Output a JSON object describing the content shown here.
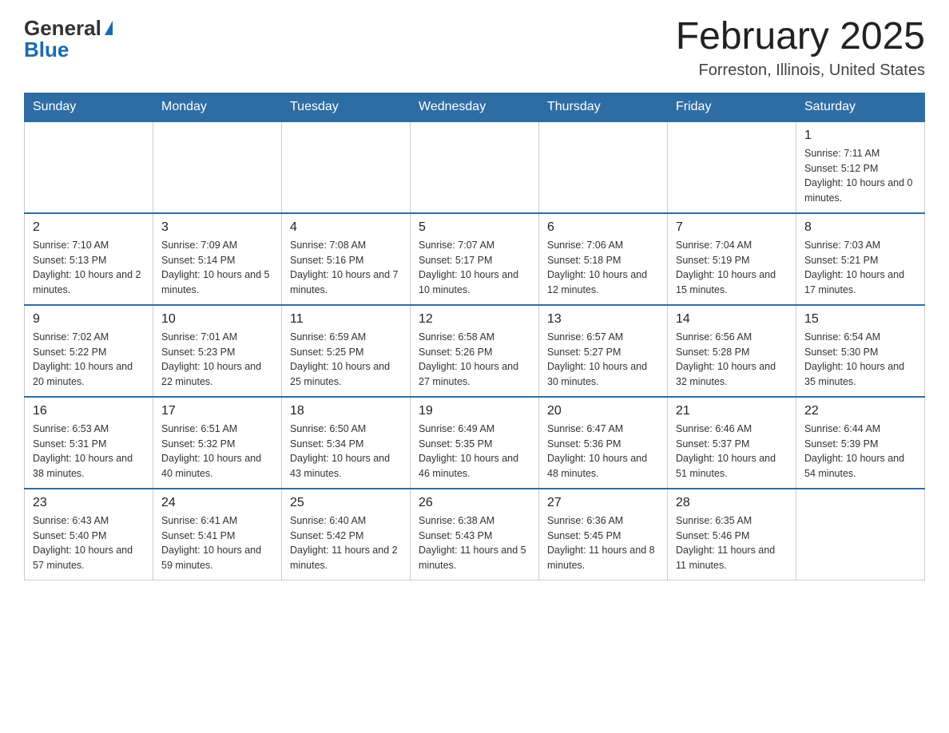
{
  "header": {
    "logo_general": "General",
    "logo_blue": "Blue",
    "month_title": "February 2025",
    "location": "Forreston, Illinois, United States"
  },
  "days_of_week": [
    "Sunday",
    "Monday",
    "Tuesday",
    "Wednesday",
    "Thursday",
    "Friday",
    "Saturday"
  ],
  "weeks": [
    [
      {
        "day": "",
        "sunrise": "",
        "sunset": "",
        "daylight": ""
      },
      {
        "day": "",
        "sunrise": "",
        "sunset": "",
        "daylight": ""
      },
      {
        "day": "",
        "sunrise": "",
        "sunset": "",
        "daylight": ""
      },
      {
        "day": "",
        "sunrise": "",
        "sunset": "",
        "daylight": ""
      },
      {
        "day": "",
        "sunrise": "",
        "sunset": "",
        "daylight": ""
      },
      {
        "day": "",
        "sunrise": "",
        "sunset": "",
        "daylight": ""
      },
      {
        "day": "1",
        "sunrise": "Sunrise: 7:11 AM",
        "sunset": "Sunset: 5:12 PM",
        "daylight": "Daylight: 10 hours and 0 minutes."
      }
    ],
    [
      {
        "day": "2",
        "sunrise": "Sunrise: 7:10 AM",
        "sunset": "Sunset: 5:13 PM",
        "daylight": "Daylight: 10 hours and 2 minutes."
      },
      {
        "day": "3",
        "sunrise": "Sunrise: 7:09 AM",
        "sunset": "Sunset: 5:14 PM",
        "daylight": "Daylight: 10 hours and 5 minutes."
      },
      {
        "day": "4",
        "sunrise": "Sunrise: 7:08 AM",
        "sunset": "Sunset: 5:16 PM",
        "daylight": "Daylight: 10 hours and 7 minutes."
      },
      {
        "day": "5",
        "sunrise": "Sunrise: 7:07 AM",
        "sunset": "Sunset: 5:17 PM",
        "daylight": "Daylight: 10 hours and 10 minutes."
      },
      {
        "day": "6",
        "sunrise": "Sunrise: 7:06 AM",
        "sunset": "Sunset: 5:18 PM",
        "daylight": "Daylight: 10 hours and 12 minutes."
      },
      {
        "day": "7",
        "sunrise": "Sunrise: 7:04 AM",
        "sunset": "Sunset: 5:19 PM",
        "daylight": "Daylight: 10 hours and 15 minutes."
      },
      {
        "day": "8",
        "sunrise": "Sunrise: 7:03 AM",
        "sunset": "Sunset: 5:21 PM",
        "daylight": "Daylight: 10 hours and 17 minutes."
      }
    ],
    [
      {
        "day": "9",
        "sunrise": "Sunrise: 7:02 AM",
        "sunset": "Sunset: 5:22 PM",
        "daylight": "Daylight: 10 hours and 20 minutes."
      },
      {
        "day": "10",
        "sunrise": "Sunrise: 7:01 AM",
        "sunset": "Sunset: 5:23 PM",
        "daylight": "Daylight: 10 hours and 22 minutes."
      },
      {
        "day": "11",
        "sunrise": "Sunrise: 6:59 AM",
        "sunset": "Sunset: 5:25 PM",
        "daylight": "Daylight: 10 hours and 25 minutes."
      },
      {
        "day": "12",
        "sunrise": "Sunrise: 6:58 AM",
        "sunset": "Sunset: 5:26 PM",
        "daylight": "Daylight: 10 hours and 27 minutes."
      },
      {
        "day": "13",
        "sunrise": "Sunrise: 6:57 AM",
        "sunset": "Sunset: 5:27 PM",
        "daylight": "Daylight: 10 hours and 30 minutes."
      },
      {
        "day": "14",
        "sunrise": "Sunrise: 6:56 AM",
        "sunset": "Sunset: 5:28 PM",
        "daylight": "Daylight: 10 hours and 32 minutes."
      },
      {
        "day": "15",
        "sunrise": "Sunrise: 6:54 AM",
        "sunset": "Sunset: 5:30 PM",
        "daylight": "Daylight: 10 hours and 35 minutes."
      }
    ],
    [
      {
        "day": "16",
        "sunrise": "Sunrise: 6:53 AM",
        "sunset": "Sunset: 5:31 PM",
        "daylight": "Daylight: 10 hours and 38 minutes."
      },
      {
        "day": "17",
        "sunrise": "Sunrise: 6:51 AM",
        "sunset": "Sunset: 5:32 PM",
        "daylight": "Daylight: 10 hours and 40 minutes."
      },
      {
        "day": "18",
        "sunrise": "Sunrise: 6:50 AM",
        "sunset": "Sunset: 5:34 PM",
        "daylight": "Daylight: 10 hours and 43 minutes."
      },
      {
        "day": "19",
        "sunrise": "Sunrise: 6:49 AM",
        "sunset": "Sunset: 5:35 PM",
        "daylight": "Daylight: 10 hours and 46 minutes."
      },
      {
        "day": "20",
        "sunrise": "Sunrise: 6:47 AM",
        "sunset": "Sunset: 5:36 PM",
        "daylight": "Daylight: 10 hours and 48 minutes."
      },
      {
        "day": "21",
        "sunrise": "Sunrise: 6:46 AM",
        "sunset": "Sunset: 5:37 PM",
        "daylight": "Daylight: 10 hours and 51 minutes."
      },
      {
        "day": "22",
        "sunrise": "Sunrise: 6:44 AM",
        "sunset": "Sunset: 5:39 PM",
        "daylight": "Daylight: 10 hours and 54 minutes."
      }
    ],
    [
      {
        "day": "23",
        "sunrise": "Sunrise: 6:43 AM",
        "sunset": "Sunset: 5:40 PM",
        "daylight": "Daylight: 10 hours and 57 minutes."
      },
      {
        "day": "24",
        "sunrise": "Sunrise: 6:41 AM",
        "sunset": "Sunset: 5:41 PM",
        "daylight": "Daylight: 10 hours and 59 minutes."
      },
      {
        "day": "25",
        "sunrise": "Sunrise: 6:40 AM",
        "sunset": "Sunset: 5:42 PM",
        "daylight": "Daylight: 11 hours and 2 minutes."
      },
      {
        "day": "26",
        "sunrise": "Sunrise: 6:38 AM",
        "sunset": "Sunset: 5:43 PM",
        "daylight": "Daylight: 11 hours and 5 minutes."
      },
      {
        "day": "27",
        "sunrise": "Sunrise: 6:36 AM",
        "sunset": "Sunset: 5:45 PM",
        "daylight": "Daylight: 11 hours and 8 minutes."
      },
      {
        "day": "28",
        "sunrise": "Sunrise: 6:35 AM",
        "sunset": "Sunset: 5:46 PM",
        "daylight": "Daylight: 11 hours and 11 minutes."
      },
      {
        "day": "",
        "sunrise": "",
        "sunset": "",
        "daylight": ""
      }
    ]
  ]
}
